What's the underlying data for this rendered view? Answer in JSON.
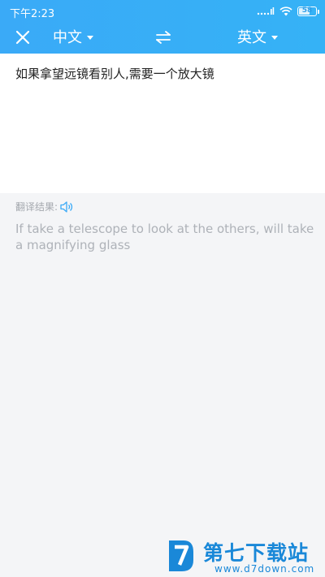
{
  "status_bar": {
    "time": "下午2:23",
    "battery": "58"
  },
  "toolbar": {
    "source_language": "中文",
    "target_language": "英文"
  },
  "input": {
    "text": "如果拿望远镜看别人,需要一个放大镜"
  },
  "result": {
    "label": "翻译结果:",
    "text": "If take a telescope to look at the others, will take a magnifying glass"
  },
  "watermark": {
    "title": "第七下载站",
    "url": "www.d7down.com"
  },
  "colors": {
    "header": "#3aaaf7",
    "background": "#f4f5f7",
    "result_text": "#aeb2b8",
    "watermark": "#1a88d8"
  },
  "icons": {
    "close": "close-icon",
    "swap": "swap-icon",
    "speaker": "speaker-icon",
    "wifi": "wifi-icon",
    "signal": "signal-icon",
    "battery": "battery-icon"
  }
}
